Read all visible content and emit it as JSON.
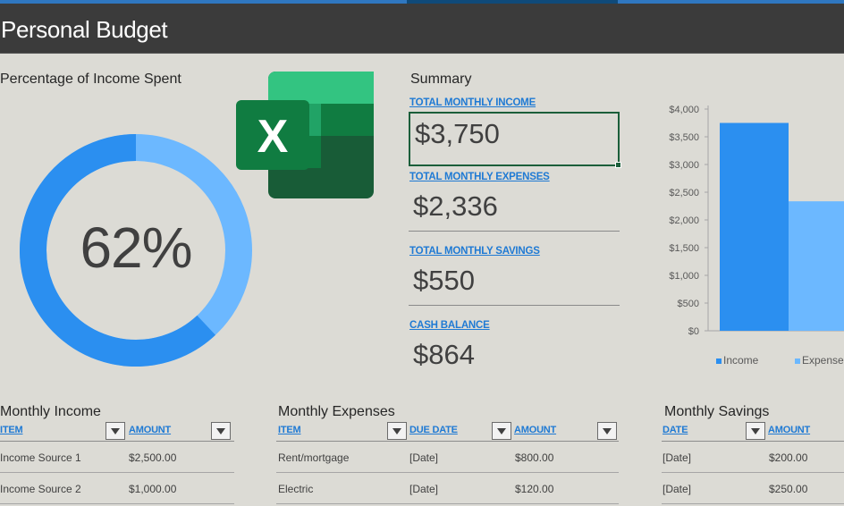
{
  "title": "Personal Budget",
  "donut": {
    "label": "Percentage of Income Spent",
    "percent_text": "62%",
    "percent_value": 62,
    "colors": {
      "spent": "#2b8ff0",
      "remaining": "#6cb8ff"
    }
  },
  "summary": {
    "title": "Summary",
    "items": [
      {
        "label": "TOTAL MONTHLY INCOME",
        "value": "$3,750"
      },
      {
        "label": "TOTAL MONTHLY EXPENSES",
        "value": "$2,336"
      },
      {
        "label": "TOTAL MONTHLY SAVINGS",
        "value": "$550"
      },
      {
        "label": "CASH BALANCE",
        "value": "$864"
      }
    ]
  },
  "chart_data": {
    "type": "bar",
    "title": "",
    "ylim": [
      0,
      4000
    ],
    "yticks": [
      "$0",
      "$500",
      "$1,000",
      "$1,500",
      "$2,000",
      "$2,500",
      "$3,000",
      "$3,500",
      "$4,000"
    ],
    "categories": [
      "Income",
      "Expenses"
    ],
    "values": [
      3750,
      2336
    ],
    "colors": [
      "#2b8ff0",
      "#6cb8ff"
    ],
    "legend": [
      "Income",
      "Expense"
    ],
    "legend_position": "bottom",
    "grid": false
  },
  "tables": {
    "income": {
      "title": "Monthly Income",
      "headers": [
        "ITEM",
        "AMOUNT"
      ],
      "rows": [
        [
          "Income Source 1",
          "$2,500.00"
        ],
        [
          "Income Source 2",
          "$1,000.00"
        ]
      ]
    },
    "expenses": {
      "title": "Monthly Expenses",
      "headers": [
        "ITEM",
        "DUE DATE",
        "AMOUNT"
      ],
      "rows": [
        [
          "Rent/mortgage",
          "[Date]",
          "$800.00"
        ],
        [
          "Electric",
          "[Date]",
          "$120.00"
        ]
      ]
    },
    "savings": {
      "title": "Monthly Savings",
      "headers": [
        "DATE",
        "AMOUNT"
      ],
      "rows": [
        [
          "[Date]",
          "$200.00"
        ],
        [
          "[Date]",
          "$250.00"
        ]
      ]
    }
  },
  "icons": {
    "logo": "excel-logo-icon",
    "filter": "filter-dropdown-icon"
  }
}
